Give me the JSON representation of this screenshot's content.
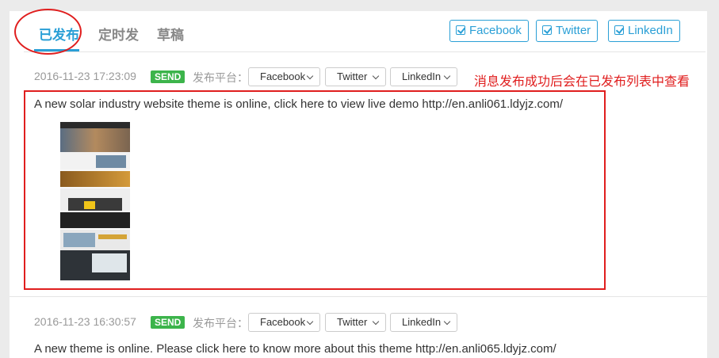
{
  "tabs": [
    {
      "label": "已发布",
      "active": true
    },
    {
      "label": "定时发",
      "active": false
    },
    {
      "label": "草稿",
      "active": false
    }
  ],
  "share_buttons": [
    "Facebook",
    "Twitter",
    "LinkedIn"
  ],
  "annotation_note": "消息发布成功后会在已发布列表中查看",
  "posts": [
    {
      "timestamp": "2016-11-23 17:23:09",
      "status": "SEND",
      "platform_label": "发布平台：",
      "platforms": [
        "Facebook",
        "Twitter",
        "LinkedIn"
      ],
      "text": "A new solar industry website theme is online, click here to view live demo http://en.anli061.ldyjz.com/"
    },
    {
      "timestamp": "2016-11-23 16:30:57",
      "status": "SEND",
      "platform_label": "发布平台：",
      "platforms": [
        "Facebook",
        "Twitter",
        "LinkedIn"
      ],
      "text": "A new theme is online. Please click here to know more about this theme http://en.anli065.ldyjz.com/"
    }
  ],
  "colors": {
    "accent": "#2a9fd6",
    "send_badge": "#3cb44b",
    "annotation_red": "#e01e1e"
  },
  "icons": {
    "share_button": "checkbox-checked-icon",
    "dropdown": "chevron-down-icon"
  }
}
